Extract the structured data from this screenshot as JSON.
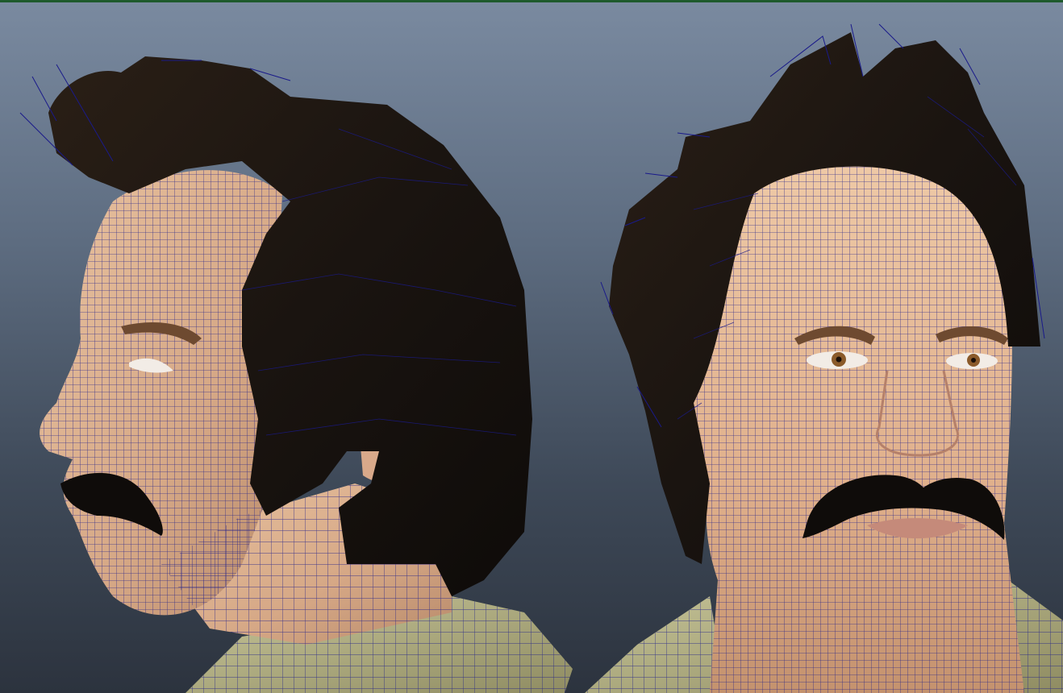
{
  "viewport": {
    "background_top": "#7a8aa0",
    "background_bottom": "#2c333e",
    "border_color": "#1e5a2c",
    "wire_color": "#1a1a8a"
  },
  "views": [
    {
      "id": "side",
      "description_icon": "head-model-side-view"
    },
    {
      "id": "front",
      "description_icon": "head-model-front-view"
    }
  ]
}
